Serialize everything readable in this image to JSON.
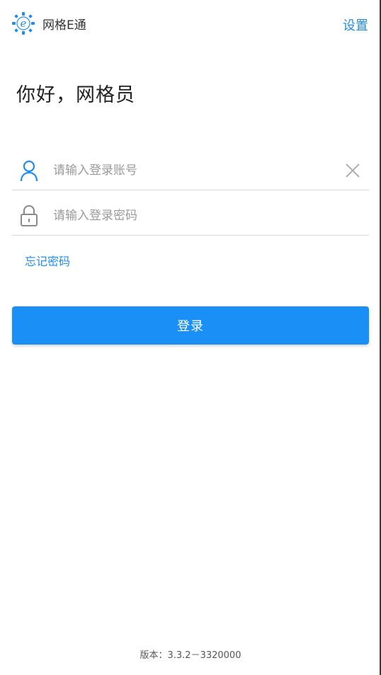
{
  "header": {
    "app_title": "网格E通",
    "settings_label": "设置",
    "logo_icon": "e-logo-icon"
  },
  "greeting": "你好，网格员",
  "form": {
    "username": {
      "placeholder": "请输入登录账号",
      "value": "",
      "icon": "user-icon",
      "clear_icon": "close-icon"
    },
    "password": {
      "placeholder": "请输入登录密码",
      "value": "",
      "icon": "lock-icon"
    },
    "forgot_label": "忘记密码",
    "login_label": "登录"
  },
  "footer": {
    "version": "版本：3.3.2－3320000"
  },
  "colors": {
    "accent": "#1a8ff5",
    "link": "#1f8ef0",
    "divider": "#d9d9d9"
  }
}
